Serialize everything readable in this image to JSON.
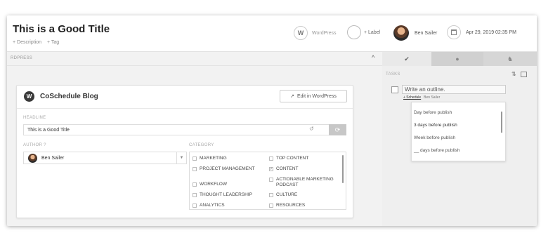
{
  "header": {
    "title": "This is a Good Title",
    "add_description": "+ Description",
    "add_tag": "+ Tag",
    "platform_label": "WordPress",
    "label_button": "+ Label",
    "user_name": "Ben Sailer",
    "date": "Apr 29, 2019 02:35 PM"
  },
  "section": {
    "label": "RDPRESS"
  },
  "card": {
    "blog_name": "CoSchedule Blog",
    "edit_button": "Edit in WordPress",
    "headline_label": "HEADLINE",
    "headline_value": "This is a Good Title",
    "author_label": "AUTHOR ?",
    "author_value": "Ben Sailer",
    "category_label": "CATEGORY",
    "categories_left": [
      {
        "label": "MARKETING",
        "checked": false
      },
      {
        "label": "PROJECT MANAGEMENT",
        "checked": false
      },
      {
        "label": "WORKFLOW",
        "checked": false
      },
      {
        "label": "THOUGHT LEADERSHIP",
        "checked": false
      },
      {
        "label": "ANALYTICS",
        "checked": false
      }
    ],
    "categories_right": [
      {
        "label": "TOP CONTENT",
        "checked": false
      },
      {
        "label": "CONTENT",
        "checked": true
      },
      {
        "label": "ACTIONABLE MARKETING PODCAST",
        "checked": false
      },
      {
        "label": "CULTURE",
        "checked": false
      },
      {
        "label": "RESOURCES",
        "checked": false
      }
    ]
  },
  "panel": {
    "tabs": [
      "check-icon",
      "comment-icon",
      "people-icon"
    ],
    "tasks_label": "TASKS",
    "task_text": "Write an outline.",
    "task_schedule": "+ Schedule",
    "task_assignee": "Ben Sailer",
    "schedule_options": [
      "Day before publish",
      "3 days before publish",
      "Week before publish",
      "__ days before publish"
    ]
  }
}
